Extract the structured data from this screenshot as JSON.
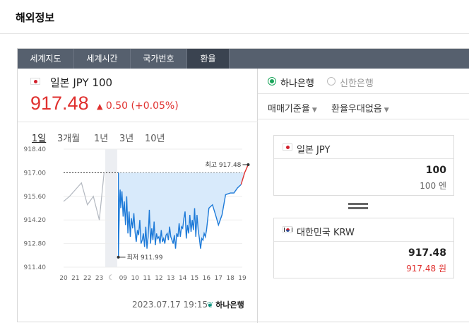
{
  "page": {
    "title": "해외정보"
  },
  "tabs": [
    {
      "label": "세계지도"
    },
    {
      "label": "세계시간"
    },
    {
      "label": "국가번호"
    },
    {
      "label": "환율",
      "active": true
    }
  ],
  "summary": {
    "flag": "jp-flag-icon",
    "currency": "일본 JPY 100",
    "rate": "917.48",
    "change": "0.50 (+0.05%)",
    "direction_icon": "up-triangle-icon",
    "up_color": "#e0312f"
  },
  "periods": [
    {
      "label": "1일",
      "active": true
    },
    {
      "label": "3개월"
    },
    {
      "label": "1년"
    },
    {
      "label": "3년"
    },
    {
      "label": "10년"
    }
  ],
  "chart_data": {
    "type": "line",
    "yticks": [
      "918.40",
      "917.00",
      "915.60",
      "914.20",
      "912.80",
      "911.40"
    ],
    "ylim": [
      911.4,
      918.4
    ],
    "xticks": [
      "20",
      "21",
      "22",
      "23",
      "moon-icon",
      "09",
      "10",
      "11",
      "12",
      "13",
      "14",
      "15",
      "16",
      "17",
      "18",
      "19"
    ],
    "prev_close": 917.0,
    "high": {
      "label": "최고 917.48",
      "value": 917.48
    },
    "low": {
      "label": "최저 911.99",
      "value": 911.99
    },
    "series": [
      {
        "x": [
          0,
          0.5,
          1,
          1.5,
          2,
          2.5,
          3,
          3.4
        ],
        "values": [
          915.3,
          915.6,
          916.0,
          916.4,
          915.1,
          915.6,
          914.2,
          917.0
        ]
      },
      {
        "x": [
          4.6,
          4.7,
          4.75,
          4.8,
          4.9,
          5.0,
          5.1,
          5.2,
          5.3,
          5.4,
          5.5,
          5.6,
          5.7,
          5.8,
          5.9,
          6.0,
          6.1,
          6.2,
          6.3,
          6.4,
          6.5,
          6.6,
          6.7,
          6.8,
          6.9,
          7.0,
          7.1,
          7.2,
          7.3,
          7.4,
          7.5,
          7.6,
          7.7,
          7.8,
          7.9,
          8.0,
          8.1,
          8.2,
          8.3,
          8.4,
          8.5,
          8.6,
          8.7,
          8.8,
          8.9,
          9.0,
          9.1,
          9.2,
          9.3,
          9.4,
          9.5,
          9.6,
          9.7,
          9.8,
          9.9,
          10.0,
          10.1,
          10.2,
          10.3,
          10.4,
          10.5,
          10.6,
          10.7,
          10.8,
          10.9,
          11.0,
          11.1,
          11.2,
          11.3,
          11.4,
          11.5,
          11.6,
          11.7,
          11.8,
          11.9,
          12.0,
          12.2,
          12.5,
          12.8,
          13.0,
          13.3,
          13.6,
          14.0,
          14.3,
          14.6,
          14.9,
          15.2,
          15.5
        ],
        "values": [
          911.99,
          915.4,
          916.0,
          914.9,
          915.9,
          914.4,
          915.3,
          913.9,
          915.6,
          913.4,
          914.7,
          913.2,
          914.3,
          913.7,
          914.6,
          913.5,
          912.9,
          913.6,
          913.3,
          914.2,
          912.8,
          913.0,
          913.4,
          912.6,
          913.8,
          912.5,
          913.2,
          914.8,
          912.8,
          913.7,
          913.0,
          914.1,
          912.7,
          913.4,
          913.1,
          913.2,
          912.8,
          913.6,
          912.9,
          913.1,
          912.8,
          913.3,
          913.4,
          913.0,
          913.8,
          913.2,
          913.0,
          912.8,
          913.3,
          912.5,
          913.4,
          913.2,
          914.0,
          913.2,
          913.8,
          913.7,
          914.3,
          914.7,
          913.1,
          913.9,
          913.4,
          914.5,
          913.5,
          914.2,
          913.6,
          914.9,
          913.2,
          914.5,
          913.6,
          913.1,
          912.5,
          913.1,
          913.0,
          913.4,
          913.2,
          913.6,
          914.9,
          915.1,
          914.4,
          913.9,
          914.5,
          915.7,
          915.8,
          915.8,
          916.1,
          916.3,
          917.0,
          917.48
        ]
      }
    ]
  },
  "footer": {
    "date": "2023.07.17 19:15",
    "bank": "하나은행",
    "bank_icon": "hana-logo-icon"
  },
  "banks": [
    {
      "label": "하나은행",
      "checked": true
    },
    {
      "label": "신한은행",
      "checked": false
    }
  ],
  "selects": [
    {
      "label": "매매기준율"
    },
    {
      "label": "환율우대없음"
    }
  ],
  "converter": {
    "from": {
      "flag": "jp-flag-icon",
      "label": "일본 JPY",
      "value": "100",
      "sub": "100 엔"
    },
    "equals_icon": "equals-icon",
    "to": {
      "flag": "kr-flag-icon",
      "label": "대한민국 KRW",
      "value": "917.48",
      "sub": "917.48 원"
    }
  }
}
